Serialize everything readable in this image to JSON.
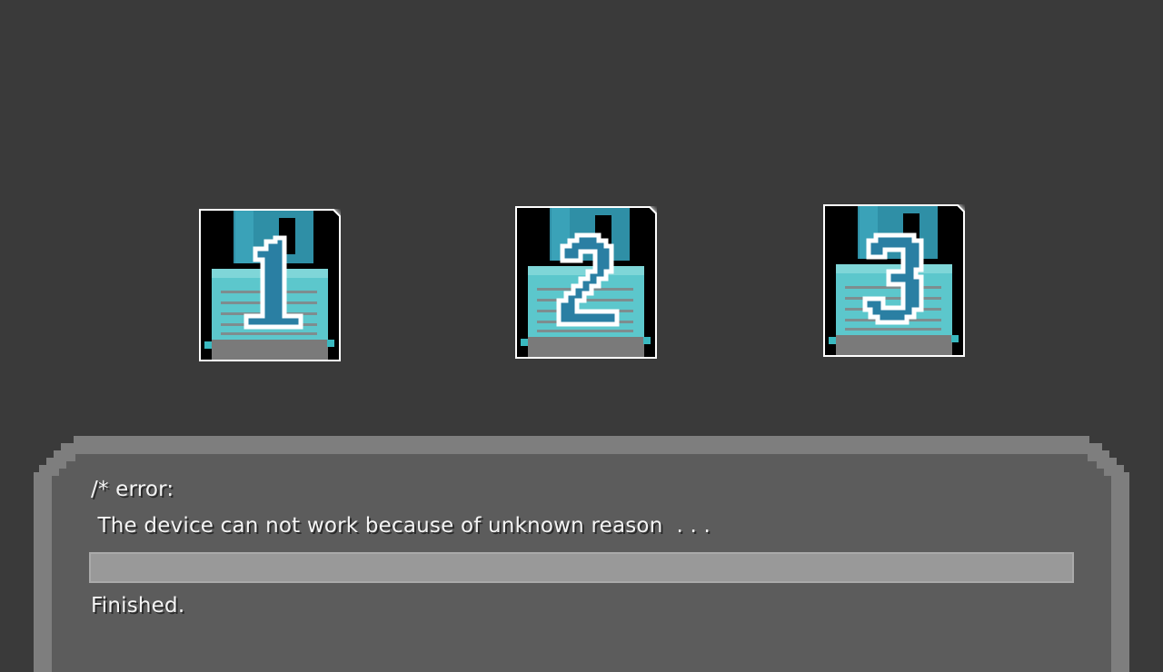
{
  "slots": [
    {
      "number": "1",
      "label": "1"
    },
    {
      "number": "2",
      "label": "2"
    },
    {
      "number": "3",
      "label": "3"
    }
  ],
  "dialog": {
    "header": "/* error:",
    "message": " The device can not work because of unknown reason  . . .",
    "progress": 1.0,
    "status": "Finished."
  },
  "colors": {
    "background": "#3a3a3a",
    "disk_body": "#000000",
    "disk_shutter": "#2f8fa6",
    "disk_label": "#5cc7cc",
    "digit_fill": "#2a7fa3",
    "glow": "#ffffff",
    "dialog_border": "#7e7e7e",
    "dialog_fill": "#5c5c5c",
    "progress_bar": "#999999"
  },
  "icons": {
    "slot_icon": "floppy-disk-icon"
  }
}
